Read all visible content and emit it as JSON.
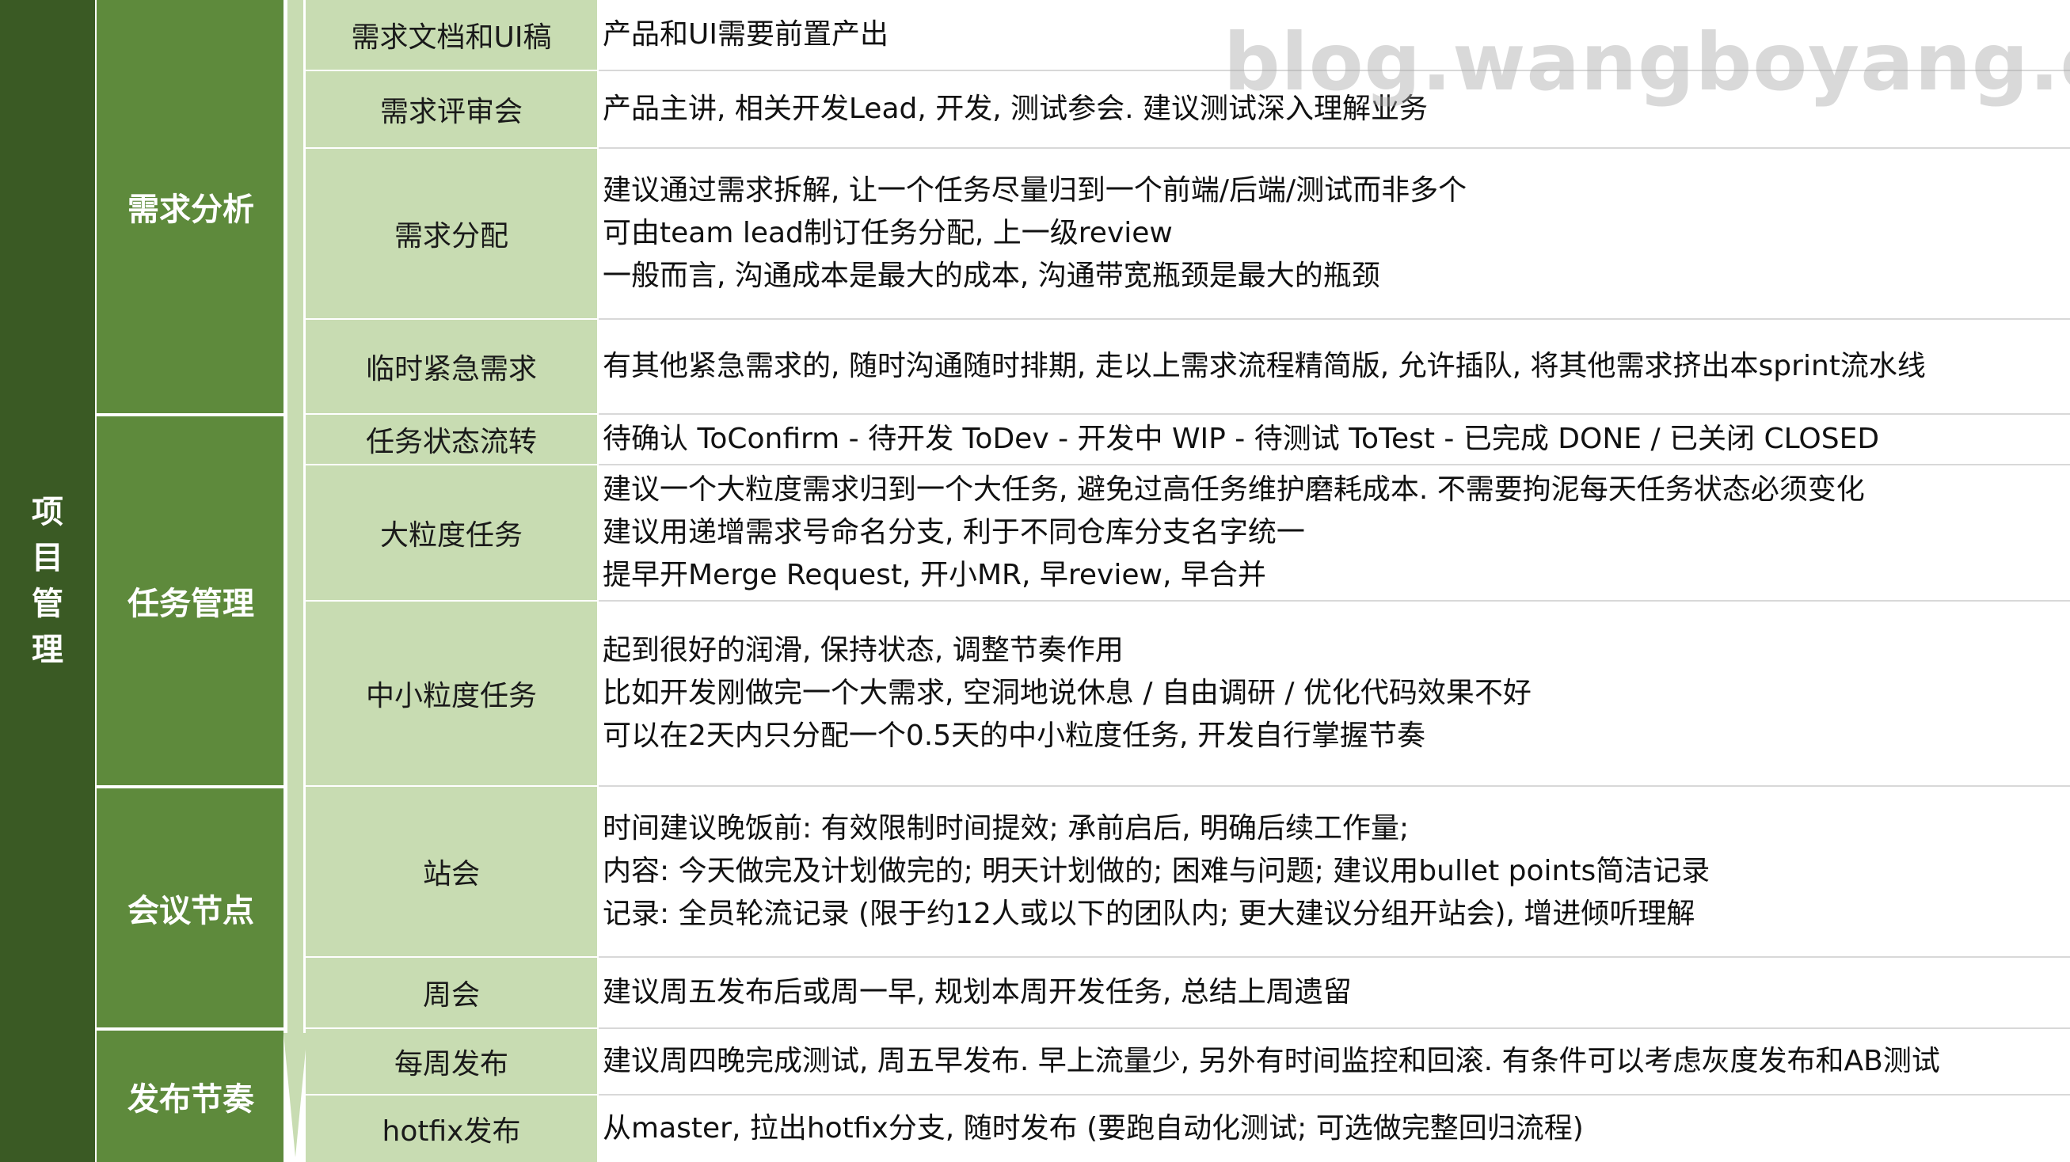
{
  "project": "项目管理",
  "categories": [
    {
      "label": "需求分析"
    },
    {
      "label": "任务管理"
    },
    {
      "label": "会议节点"
    },
    {
      "label": "发布节奏"
    }
  ],
  "rows": [
    {
      "label": "需求文档和UI稿",
      "lines": [
        "产品和UI需要前置产出"
      ]
    },
    {
      "label": "需求评审会",
      "lines": [
        "产品主讲, 相关开发Lead, 开发, 测试参会. 建议测试深入理解业务"
      ]
    },
    {
      "label": "需求分配",
      "lines": [
        "建议通过需求拆解, 让一个任务尽量归到一个前端/后端/测试而非多个",
        "可由team lead制订任务分配, 上一级review",
        "一般而言, 沟通成本是最大的成本, 沟通带宽瓶颈是最大的瓶颈"
      ]
    },
    {
      "label": "临时紧急需求",
      "lines": [
        "有其他紧急需求的, 随时沟通随时排期, 走以上需求流程精简版, 允许插队, 将其他需求挤出本sprint流水线"
      ]
    },
    {
      "label": "任务状态流转",
      "lines": [
        "待确认 ToConfirm - 待开发 ToDev - 开发中 WIP - 待测试 ToTest - 已完成 DONE / 已关闭 CLOSED"
      ]
    },
    {
      "label": "大粒度任务",
      "lines": [
        "建议一个大粒度需求归到一个大任务, 避免过高任务维护磨耗成本. 不需要拘泥每天任务状态必须变化",
        "建议用递增需求号命名分支, 利于不同仓库分支名字统一",
        "提早开Merge Request, 开小MR, 早review, 早合并"
      ]
    },
    {
      "label": "中小粒度任务",
      "lines": [
        "起到很好的润滑, 保持状态, 调整节奏作用",
        "比如开发刚做完一个大需求, 空洞地说休息 / 自由调研 / 优化代码效果不好",
        "可以在2天内只分配一个0.5天的中小粒度任务, 开发自行掌握节奏"
      ]
    },
    {
      "label": "站会",
      "lines": [
        "时间建议晚饭前: 有效限制时间提效; 承前启后, 明确后续工作量;",
        "内容: 今天做完及计划做完的; 明天计划做的; 困难与问题; 建议用bullet points简洁记录",
        "记录: 全员轮流记录 (限于约12人或以下的团队内; 更大建议分组开站会), 增进倾听理解"
      ]
    },
    {
      "label": "周会",
      "lines": [
        "建议周五发布后或周一早, 规划本周开发任务, 总结上周遗留"
      ]
    },
    {
      "label": "每周发布",
      "lines": [
        "建议周四晚完成测试, 周五早发布. 早上流量少, 另外有时间监控和回滚. 有条件可以考虑灰度发布和AB测试"
      ]
    },
    {
      "label": "hotfix发布",
      "lines": [
        "从master, 拉出hotfix分支, 随时发布 (要跑自动化测试; 可选做完整回归流程)"
      ]
    }
  ],
  "watermark": "blog.wangboyang.com",
  "colors": {
    "dark": "#3a5a24",
    "mid": "#5e8a3c",
    "light": "#c8dcb2"
  }
}
